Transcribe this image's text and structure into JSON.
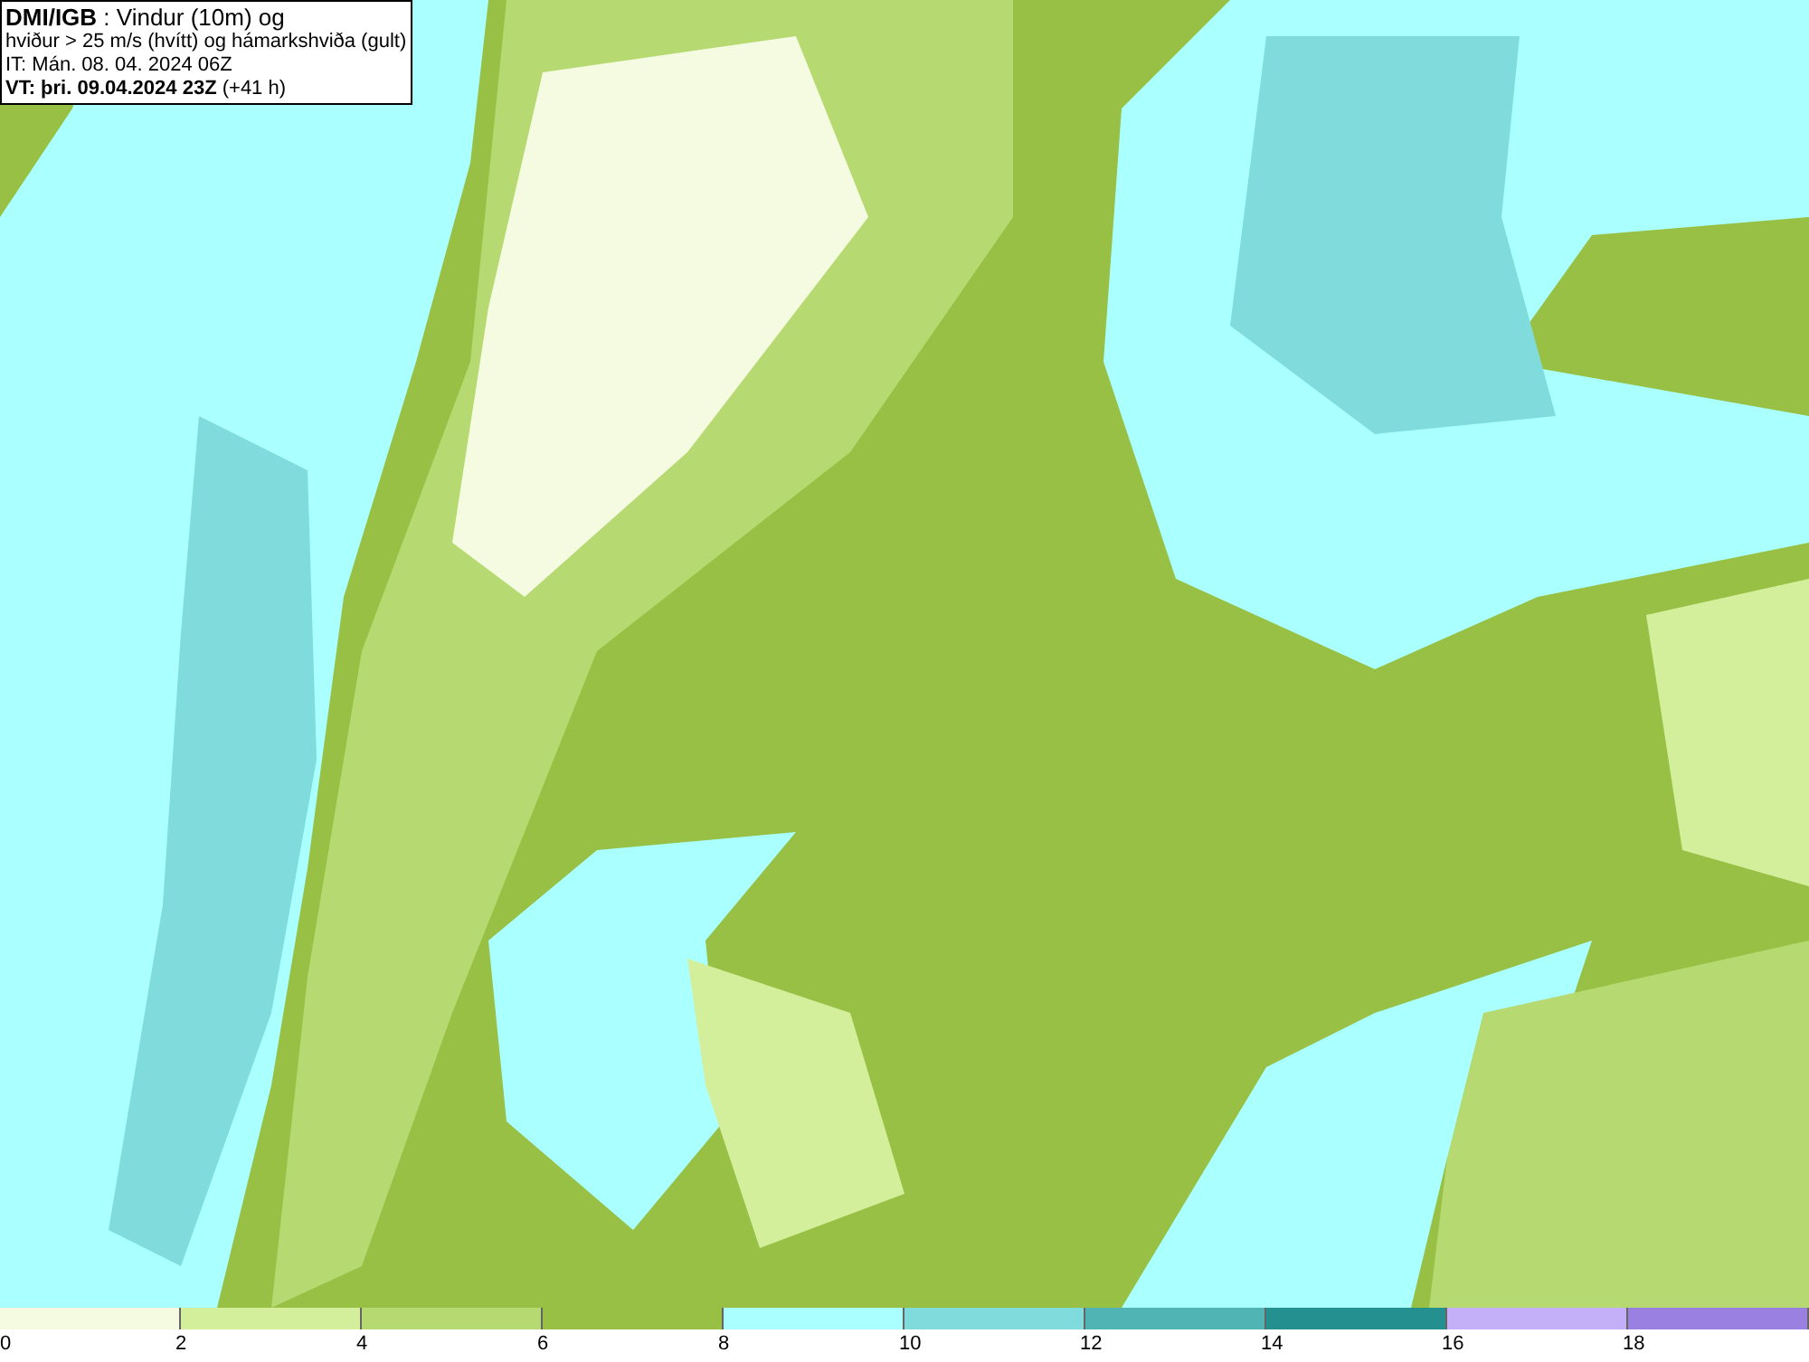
{
  "header": {
    "lines": [
      "**DMI/IGB** : Vindur (10m) og",
      "hviður > 25 m/s (hvítt) og hámarkshviða (gult)",
      "IT: Mán. 08. 04. 2024 06Z",
      "**VT: þri. 09.04.2024 23Z** (+41 h)"
    ]
  },
  "legend": {
    "segments": [
      {
        "color": "#f4fbe0"
      },
      {
        "color": "#d4ef9c"
      },
      {
        "color": "#b6d972"
      },
      {
        "color": "#98c044"
      },
      {
        "color": "#aaffff"
      },
      {
        "color": "#80dcdc"
      },
      {
        "color": "#50b4b4"
      },
      {
        "color": "#249090"
      },
      {
        "color": "#c4b0f8"
      },
      {
        "color": "#9a80e0"
      }
    ],
    "ticks": [
      "0",
      "2",
      "4",
      "6",
      "8",
      "10",
      "12",
      "14",
      "16",
      "18"
    ]
  }
}
